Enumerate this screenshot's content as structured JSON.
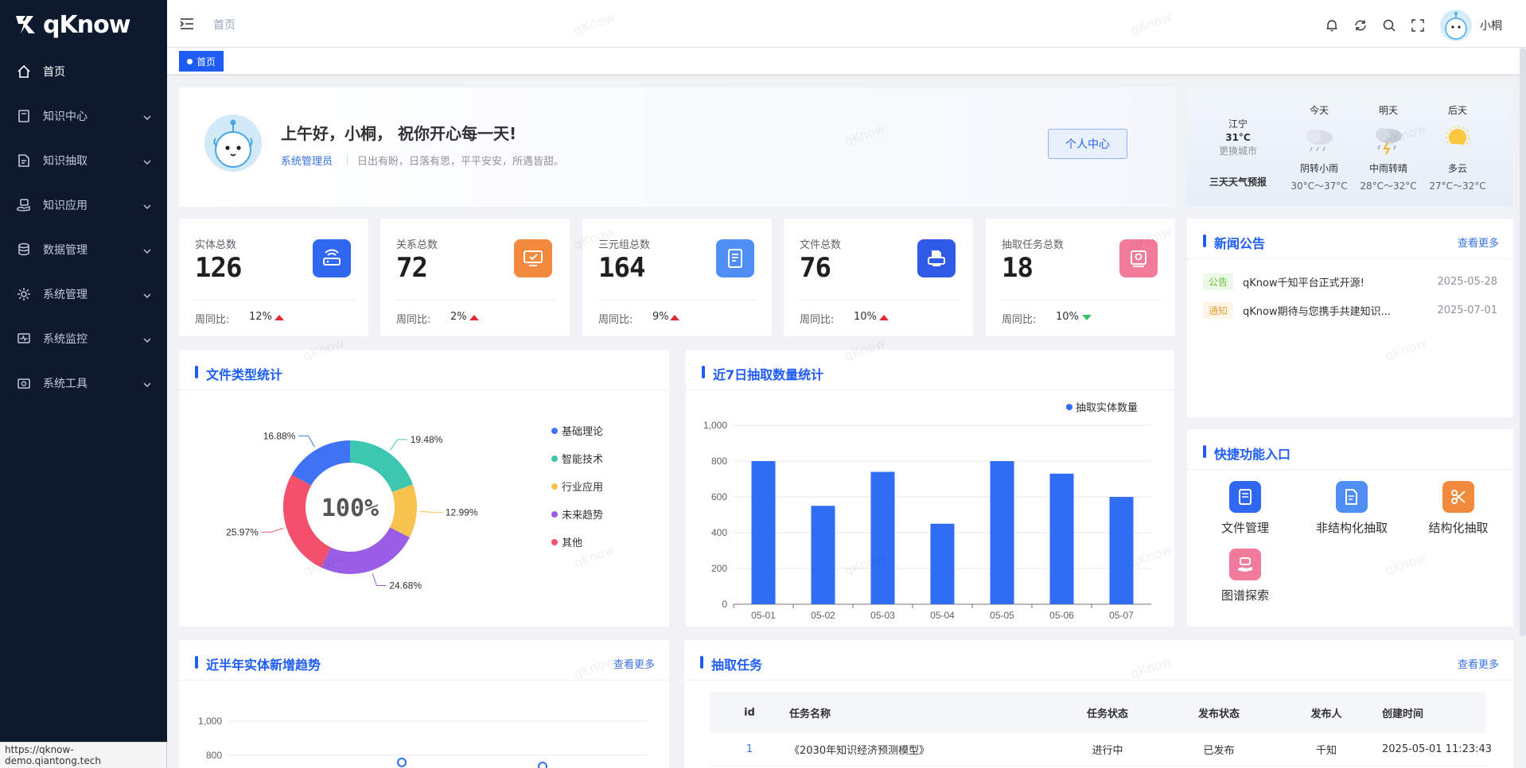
{
  "app": {
    "logo": "qKnow",
    "status_url": "https://qknow-demo.qiantong.tech"
  },
  "sidebar": {
    "items": [
      {
        "label": "首页",
        "icon": "home-icon",
        "active": true
      },
      {
        "label": "知识中心",
        "icon": "book-icon"
      },
      {
        "label": "知识抽取",
        "icon": "document-icon"
      },
      {
        "label": "知识应用",
        "icon": "hand-icon"
      },
      {
        "label": "数据管理",
        "icon": "database-icon"
      },
      {
        "label": "系统管理",
        "icon": "gear-icon"
      },
      {
        "label": "系统监控",
        "icon": "monitor-icon"
      },
      {
        "label": "系统工具",
        "icon": "toolbox-icon"
      }
    ]
  },
  "header": {
    "breadcrumb": "首页",
    "user_name": "小桐"
  },
  "tags": {
    "active": "首页"
  },
  "welcome": {
    "greeting": "上午好，小桐， 祝你开心每一天!",
    "role": "系统管理员",
    "motto": "日出有盼，日落有思，平平安安，所遇皆甜。",
    "profile_button": "个人中心"
  },
  "weather": {
    "city": "江宁",
    "temp": "31°C",
    "change_city": "更换城市",
    "forecast_label": "三天天气预报",
    "days": [
      {
        "name": "今天",
        "desc": "阴转小雨",
        "range": "30°C～37°C",
        "icon": "cloud-rain-icon"
      },
      {
        "name": "明天",
        "desc": "中雨转晴",
        "range": "28°C～32°C",
        "icon": "cloud-thunder-icon"
      },
      {
        "name": "后天",
        "desc": "多云",
        "range": "27°C～32°C",
        "icon": "sun-cloud-icon"
      }
    ]
  },
  "stats": [
    {
      "title": "实体总数",
      "value": "126",
      "wow_label": "周同比:",
      "pct": "12%",
      "trend": "up",
      "color": "#2f67f0",
      "icon": "router-icon"
    },
    {
      "title": "关系总数",
      "value": "72",
      "wow_label": "周同比:",
      "pct": "2%",
      "trend": "up",
      "color": "#f18a3c",
      "icon": "monitor-check-icon"
    },
    {
      "title": "三元组总数",
      "value": "164",
      "wow_label": "周同比:",
      "pct": "9%",
      "trend": "up",
      "color": "#4f8ff5",
      "icon": "doc-icon"
    },
    {
      "title": "文件总数",
      "value": "76",
      "wow_label": "周同比:",
      "pct": "10%",
      "trend": "up",
      "color": "#2f5be8",
      "icon": "printer-icon"
    },
    {
      "title": "抽取任务总数",
      "value": "18",
      "wow_label": "周同比:",
      "pct": "10%",
      "trend": "down",
      "color": "#f27a9a",
      "icon": "task-icon"
    }
  ],
  "news": {
    "title": "新闻公告",
    "more": "查看更多",
    "items": [
      {
        "tag": "公告",
        "title": "qKnow千知平台正式开源!",
        "date": "2025-05-28",
        "tag_color": "#67c23a",
        "tag_bg": "#eef8e8"
      },
      {
        "tag": "通知",
        "title": "qKnow期待与您携手共建知识...",
        "date": "2025-07-01",
        "tag_color": "#e6a23c",
        "tag_bg": "#fdf5e6"
      }
    ]
  },
  "quick": {
    "title": "快捷功能入口",
    "items": [
      {
        "label": "文件管理",
        "color": "#2f67f0",
        "icon": "file-icon"
      },
      {
        "label": "非结构化抽取",
        "color": "#4f8ff5",
        "icon": "doc-edit-icon"
      },
      {
        "label": "结构化抽取",
        "color": "#f18a3c",
        "icon": "scissors-icon"
      },
      {
        "label": "图谱探索",
        "color": "#f27a9a",
        "icon": "graph-hand-icon"
      }
    ]
  },
  "pie": {
    "title": "文件类型统计",
    "center_label": "100%",
    "chart_data": {
      "type": "pie",
      "labels": [
        "基础理论",
        "智能技术",
        "行业应用",
        "未来趋势",
        "其他"
      ],
      "values": [
        16.88,
        19.48,
        12.99,
        24.68,
        25.97
      ],
      "value_labels": [
        "16.88%",
        "19.48%",
        "12.99%",
        "24.68%",
        "25.97%"
      ],
      "colors": [
        "#3f72f5",
        "#3dc7b1",
        "#f8c24f",
        "#9a5ee6",
        "#f2506b"
      ]
    }
  },
  "bar": {
    "title": "近7日抽取数量统计",
    "chart_data": {
      "type": "bar",
      "categories": [
        "05-01",
        "05-02",
        "05-03",
        "05-04",
        "05-05",
        "05-06",
        "05-07"
      ],
      "series": [
        {
          "name": "抽取实体数量",
          "values": [
            800,
            550,
            740,
            450,
            800,
            730,
            600
          ]
        }
      ],
      "ylim": [
        0,
        1000
      ],
      "yticks": [
        "0",
        "200",
        "400",
        "600",
        "800",
        "1,000"
      ],
      "color": "#2f6df5"
    }
  },
  "trend": {
    "title": "近半年实体新增趋势",
    "more": "查看更多",
    "yticks": [
      "1,000",
      "800"
    ]
  },
  "tasks": {
    "title": "抽取任务",
    "more": "查看更多",
    "columns": [
      "id",
      "任务名称",
      "任务状态",
      "发布状态",
      "发布人",
      "创建时间"
    ],
    "rows": [
      [
        "1",
        "《2030年知识经济预测模型》",
        "进行中",
        "已发布",
        "千知",
        "2025-05-01 11:23:43"
      ]
    ]
  },
  "watermark": "qKnow"
}
